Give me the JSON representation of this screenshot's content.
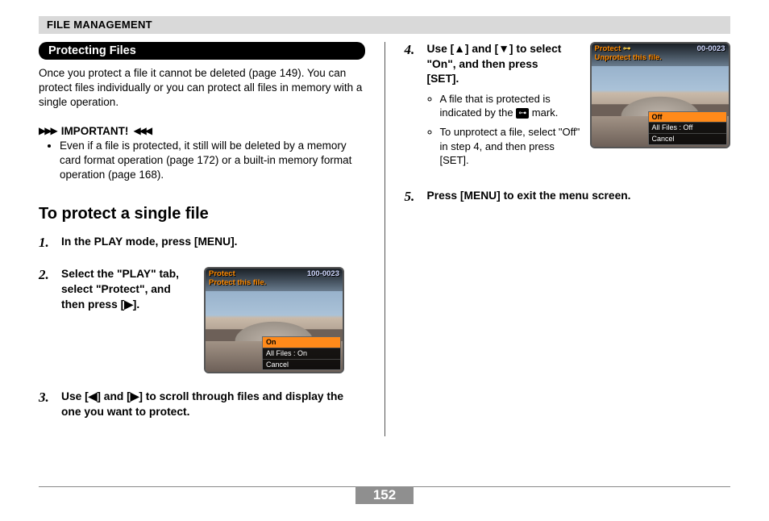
{
  "header": "FILE MANAGEMENT",
  "pill_title": "Protecting Files",
  "intro": "Once you protect a file it cannot be deleted (page 149). You can protect files individually or you can protect all files in memory with a single operation.",
  "important_label": "IMPORTANT!",
  "important_bullet": "Even if a file is protected, it still will be deleted by a memory card format operation (page 172) or a built-in memory format operation (page 168).",
  "subhead": "To protect a single file",
  "step1_num": "1.",
  "step1_text": "In the PLAY mode, press [MENU].",
  "step2_num": "2.",
  "step2_text": "Select the \"PLAY\" tab, select \"Protect\", and then press [▶].",
  "step3_num": "3.",
  "step3_text": "Use [◀] and [▶] to scroll through files and display the one you want to protect.",
  "step4_num": "4.",
  "step4_text": "Use [▲] and [▼] to select \"On\", and then press [SET].",
  "step4_sub1_a": "A file that is protected is indicated by the ",
  "step4_sub1_b": " mark.",
  "step4_sub2": "To unprotect a file, select \"Off\" in step 4, and then press [SET].",
  "step5_num": "5.",
  "step5_text": "Press [MENU] to exit the menu screen.",
  "key_icon_label": "⊶",
  "lcd1": {
    "title": "Protect",
    "subtitle": "Protect this file.",
    "fileno": "100-0023",
    "menu_sel": "On",
    "menu_row2": "All Files : On",
    "menu_row3": "Cancel"
  },
  "lcd2": {
    "title": "Protect",
    "subtitle": "Unprotect this file.",
    "fileno": "00-0023",
    "keyicon": "⊶",
    "menu_sel": "Off",
    "menu_row2": "All Files : Off",
    "menu_row3": "Cancel"
  },
  "page_number": "152"
}
